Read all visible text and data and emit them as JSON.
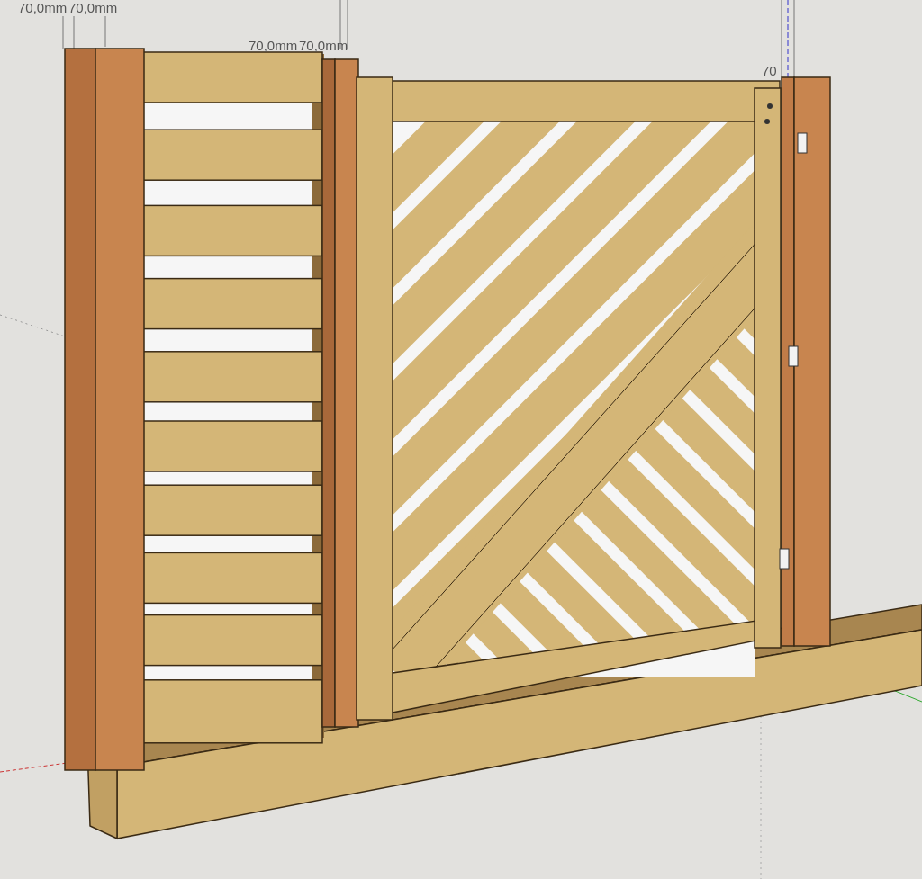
{
  "viewport": {
    "dimension_labels": [
      {
        "text": "70,0mm"
      },
      {
        "text": "70,0mm"
      },
      {
        "text": "70,0mm"
      },
      {
        "text": "70,0mm"
      },
      {
        "text": "70"
      }
    ]
  }
}
